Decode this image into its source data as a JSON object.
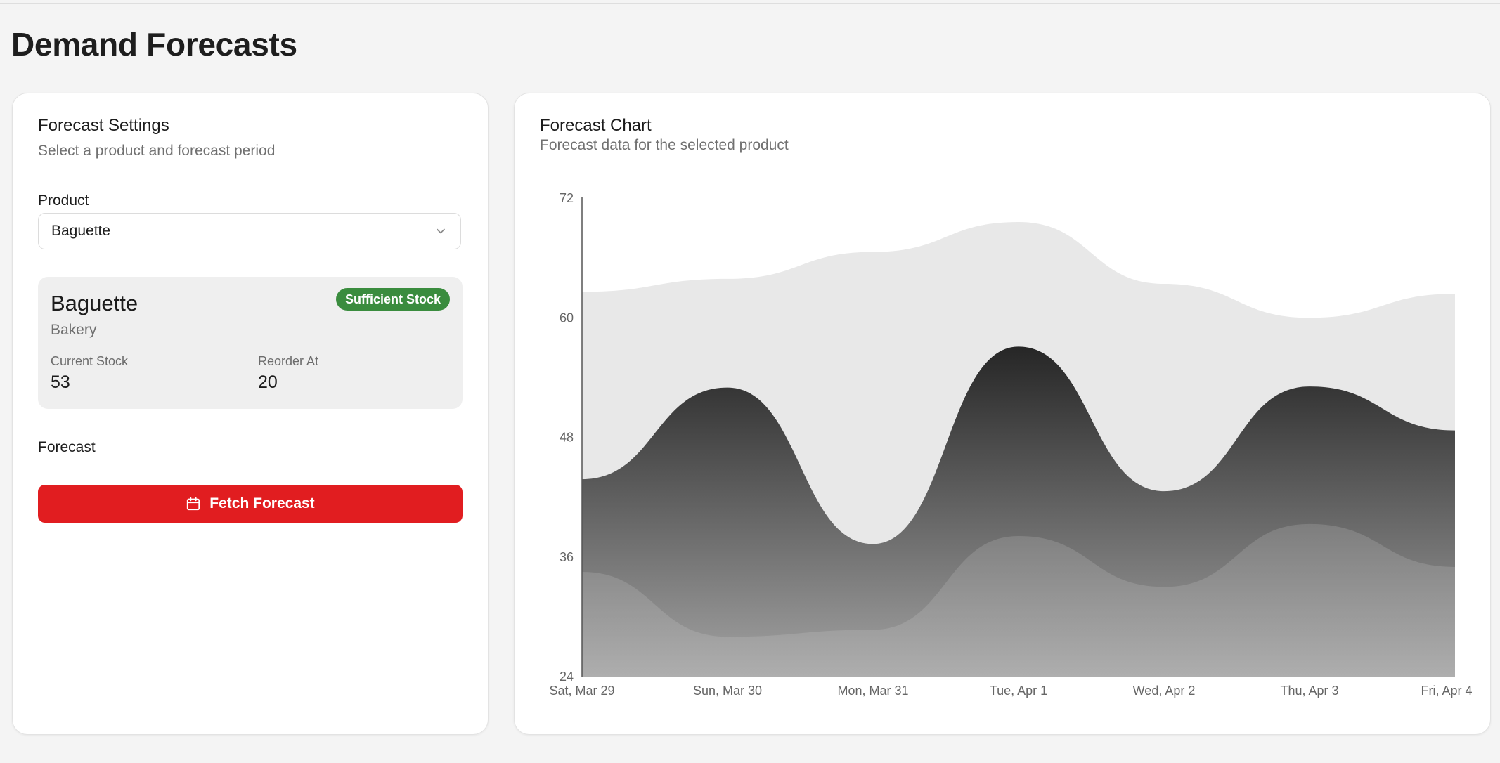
{
  "page": {
    "title": "Demand Forecasts"
  },
  "settings": {
    "title": "Forecast Settings",
    "subtitle": "Select a product and forecast period",
    "product_label": "Product",
    "selected_product": "Baguette",
    "forecast_label": "Forecast",
    "fetch_button_label": "Fetch Forecast",
    "icons": {
      "dropdown": "chevron-down-icon",
      "fetch": "calendar-icon"
    }
  },
  "product_card": {
    "name": "Baguette",
    "category": "Bakery",
    "status_badge": "Sufficient Stock",
    "status_color": "#3a8c3e",
    "current_stock_label": "Current Stock",
    "current_stock": "53",
    "reorder_label": "Reorder At",
    "reorder_at": "20"
  },
  "chart_card": {
    "title": "Forecast Chart",
    "subtitle": "Forecast data for the selected product"
  },
  "colors": {
    "accent": "#e11d20",
    "badge": "#3a8c3e",
    "upper_band": "#e8e8e8",
    "forecast_dark": "#2d2d2d"
  },
  "chart_data": {
    "type": "area",
    "categories": [
      "Sat, Mar 29",
      "Sun, Mar 30",
      "Mon, Mar 31",
      "Tue, Apr 1",
      "Wed, Apr 2",
      "Thu, Apr 3",
      "Fri, Apr 4"
    ],
    "yticks": [
      24,
      36,
      48,
      60,
      72
    ],
    "ylim": [
      24,
      72
    ],
    "grid": false,
    "legend": "none",
    "series": [
      {
        "values": [
          62.6,
          63.9,
          66.6,
          69.6,
          63.4,
          60.0,
          62.4
        ]
      },
      {
        "values": [
          43.8,
          53.0,
          37.3,
          57.1,
          42.6,
          53.1,
          48.7
        ]
      },
      {
        "values": [
          34.5,
          28.0,
          28.7,
          38.1,
          33.0,
          39.3,
          35.0
        ]
      }
    ]
  }
}
